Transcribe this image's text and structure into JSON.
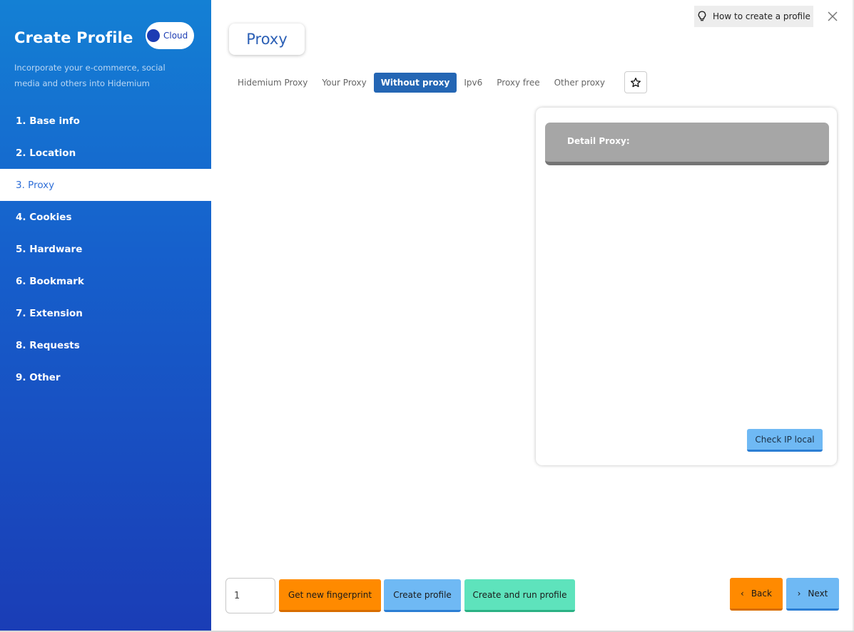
{
  "sidebar": {
    "title": "Create Profile",
    "cloud_label": "Cloud",
    "description": "Incorporate your e-commerce, social media and others into Hidemium",
    "items": [
      {
        "label": "1. Base info"
      },
      {
        "label": "2. Location"
      },
      {
        "label": "3. Proxy"
      },
      {
        "label": "4. Cookies"
      },
      {
        "label": "5. Hardware"
      },
      {
        "label": "6. Bookmark"
      },
      {
        "label": "7. Extension"
      },
      {
        "label": "8. Requests"
      },
      {
        "label": "9. Other"
      }
    ],
    "active_index": 2
  },
  "header": {
    "section_title": "Proxy",
    "help_label": "How to create a profile"
  },
  "tabs": [
    {
      "label": "Hidemium Proxy"
    },
    {
      "label": "Your Proxy"
    },
    {
      "label": "Without proxy"
    },
    {
      "label": "Ipv6"
    },
    {
      "label": "Proxy free"
    },
    {
      "label": "Other proxy"
    }
  ],
  "active_tab_index": 2,
  "detail": {
    "heading": "Detail Proxy:",
    "check_ip_label": "Check IP local"
  },
  "footer": {
    "quantity_value": "1",
    "get_fingerprint_label": "Get new fingerprint",
    "create_profile_label": "Create profile",
    "create_run_label": "Create and run profile",
    "back_label": "Back",
    "next_label": "Next"
  },
  "colors": {
    "accent": "#2466b4",
    "orange": "#ff8a00",
    "blue": "#6fb9f4",
    "green": "#5ee3bc"
  }
}
